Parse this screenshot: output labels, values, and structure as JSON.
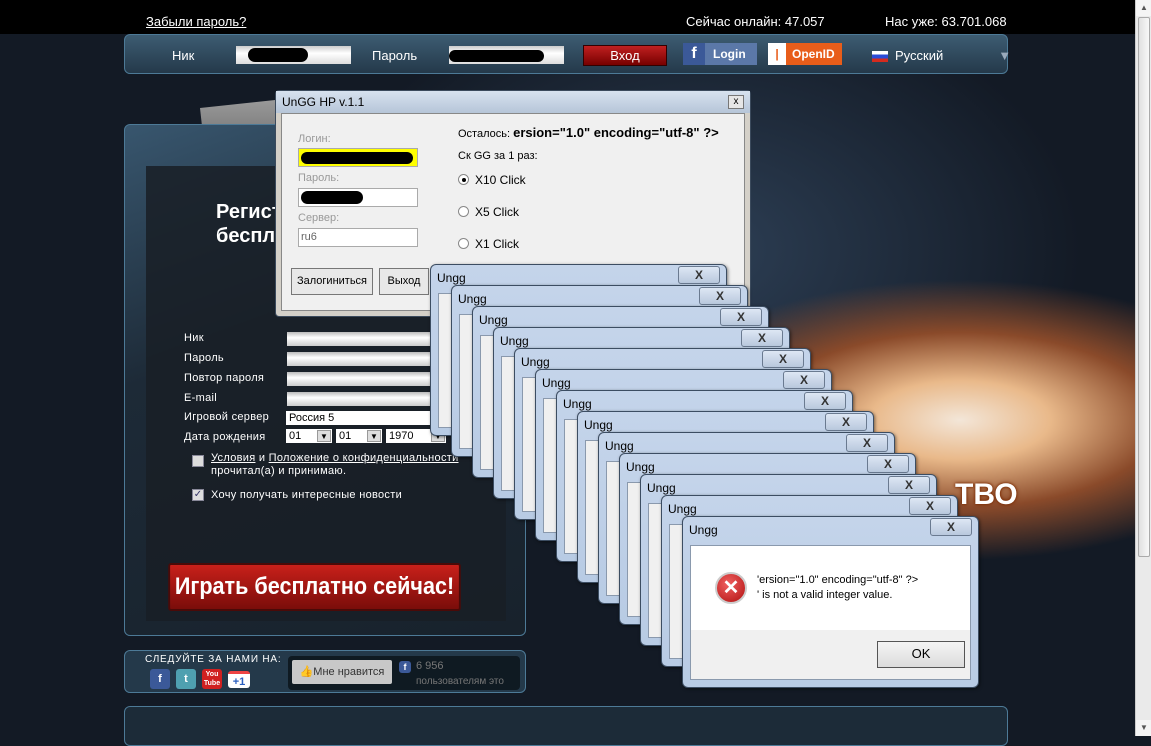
{
  "site": {
    "forgot_password": "Забыли пароль?",
    "online": "Сейчас онлайн: 47.057",
    "total": "Нас уже: 63.701.068",
    "login": {
      "nick_label": "Ник",
      "password_label": "Пароль",
      "enter": "Вход",
      "facebook_login": "Login",
      "openid": "OpenID",
      "language": "Русский"
    },
    "registration": {
      "title_line1": "Регистрация",
      "title_line2": "бесплатно",
      "fields": [
        {
          "label": "Ник"
        },
        {
          "label": "Пароль"
        },
        {
          "label": "Повтор пароля"
        },
        {
          "label": "E-mail"
        }
      ],
      "server_label": "Игровой сервер",
      "server_value": "Россия 5",
      "birth_label": "Дата рождения",
      "day": "01",
      "month": "01",
      "year": "1970",
      "terms_link1": "Условия",
      "terms_and": "и",
      "terms_link2": "Положение о конфиденциальности",
      "terms_rest": "прочитал(а) и принимаю.",
      "terms_checked": false,
      "news_label": "Хочу получать интересные новости",
      "news_checked": true,
      "play_button": "Играть бесплатно сейчас!"
    },
    "social": {
      "follow": "СЛЕДУЙТЕ ЗА НАМИ НА:",
      "icons": [
        "f",
        "t",
        "You Tube",
        "+1"
      ],
      "like_button": "Мне нравится",
      "like_count": "6 956",
      "like_text": "пользователям это"
    },
    "background_word": "ТВО"
  },
  "app": {
    "title": "UnGG HP v.1.1",
    "login_label": "Логин:",
    "password_label": "Пароль:",
    "server_label": "Сервер:",
    "server_value": "ru6",
    "remaining_label": "Осталось:",
    "remaining_value": "ersion=\"1.0\" encoding=\"utf-8\" ?>",
    "gg_label": "Ск GG за 1 раз:",
    "options": [
      {
        "label": "X10 Click",
        "selected": true
      },
      {
        "label": "X5 Click",
        "selected": false
      },
      {
        "label": "X1 Click",
        "selected": false
      }
    ],
    "login_button": "Залогиниться",
    "exit_button": "Выход"
  },
  "error_dialogs": {
    "count": 13,
    "title": "Ungg",
    "message_line1": "'ersion=\"1.0\" encoding=\"utf-8\" ?>",
    "message_line2": "' is not a valid integer value.",
    "ok": "OK"
  }
}
